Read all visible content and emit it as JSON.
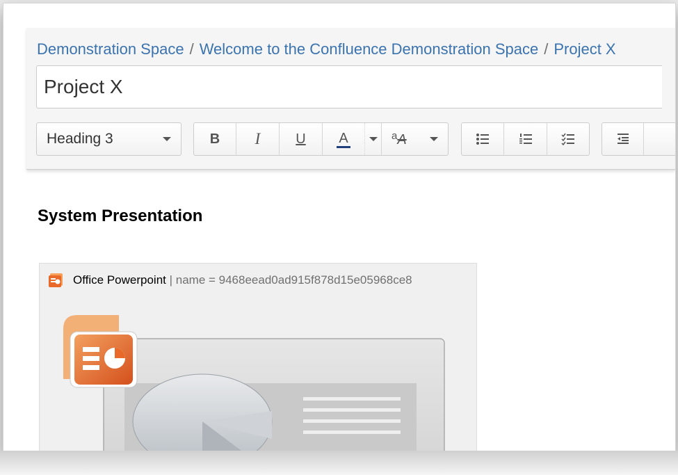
{
  "breadcrumb": [
    {
      "label": "Demonstration Space"
    },
    {
      "label": "Welcome to the Confluence Demonstration Space"
    },
    {
      "label": "Project X"
    }
  ],
  "breadcrumb_separator": "/",
  "page_title_value": "Project X",
  "toolbar": {
    "paragraph_style": "Heading 3",
    "bold": "B",
    "italic": "I",
    "underline": "U",
    "text_color": "A",
    "format_glyph_small": "a",
    "format_glyph_big": "A"
  },
  "content": {
    "heading": "System Presentation",
    "macro": {
      "app_name": "Office Powerpoint",
      "meta": "| name = 9468eead0ad915f878d15e05968ce8"
    }
  },
  "colors": {
    "link": "#3b73af",
    "ppt_orange": "#e8692a",
    "text_color_bar": "#1f3f7a"
  },
  "icons": {
    "macro_icon": "powerpoint-icon",
    "preview_logo": "powerpoint-logo-icon"
  }
}
